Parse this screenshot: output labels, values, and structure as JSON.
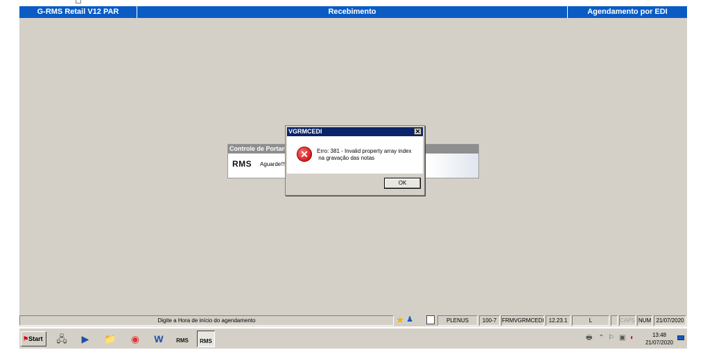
{
  "title_bar": {
    "app": "G-RMS Retail V12 PAR",
    "module": "Recebimento",
    "screen": "Agendamento por EDI"
  },
  "background_window": {
    "title": "Controle de Portaria",
    "logo": "RMS",
    "message": "Aguarde!!!"
  },
  "dialog": {
    "title": "VGRMCEDI",
    "close_glyph": "✕",
    "icon": "error-x-icon",
    "message": "Erro: 381 - Invalid property array index\n na gravação das notas",
    "ok_label": "OK"
  },
  "status_bar": {
    "hint": "Digite a Hora de início do agendamento",
    "user": "PLENUS",
    "branch": "100-7",
    "form": "FRMVGRMCEDI",
    "version": "12.23.1",
    "mode": "L",
    "caps": "CAPS",
    "num": "NUM",
    "date": "21/07/2020"
  },
  "taskbar": {
    "start_label": "Start",
    "items": [
      {
        "icon": "network-icon",
        "glyph": "🖧"
      },
      {
        "icon": "powershell-icon",
        "glyph": "▶"
      },
      {
        "icon": "file-explorer-icon",
        "glyph": "📁"
      },
      {
        "icon": "chrome-icon",
        "glyph": "◉"
      },
      {
        "icon": "word-icon",
        "glyph": "W"
      },
      {
        "icon": "rms-app-icon",
        "glyph": "RMS"
      },
      {
        "icon": "rms-app-icon-active",
        "glyph": "RMS"
      }
    ],
    "clock_time": "13:48",
    "clock_date": "21/07/2020"
  },
  "colors": {
    "title_blue": "#0a5cc4",
    "dialog_title": "#0a246a",
    "window_gray": "#d4d0c8",
    "error_red": "#c80000"
  }
}
